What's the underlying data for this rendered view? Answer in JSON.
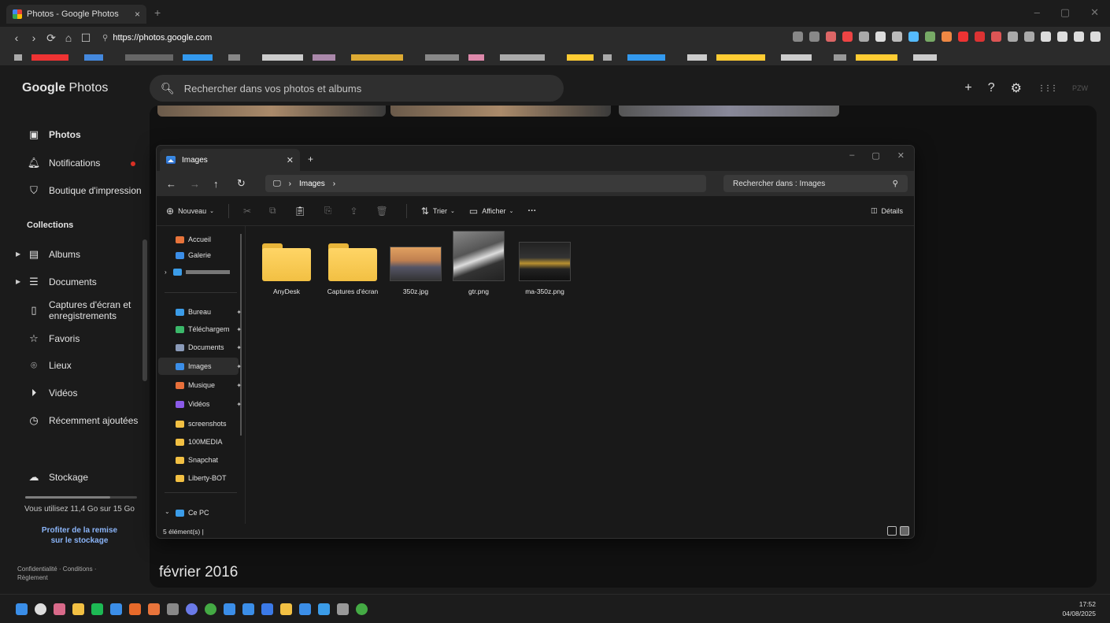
{
  "browser": {
    "tab_title": "Photos - Google Photos",
    "tab_close": "×",
    "new_tab": "+",
    "window_controls": [
      "–",
      "▢",
      "✕"
    ],
    "nav_buttons": [
      "‹",
      "›",
      "⟳",
      "⌂",
      "☐"
    ],
    "url": "https://photos.google.com",
    "extension_colors": [
      "#888888",
      "#888888",
      "#d66",
      "#e44",
      "#aaa",
      "#ddd",
      "#bbb",
      "#5bf",
      "#7a6",
      "#e84",
      "#e33",
      "#d33",
      "#d55",
      "#aaa",
      "#aaa",
      "#ddd",
      "#ddd",
      "#ddd",
      "#ddd"
    ]
  },
  "photos": {
    "logo_bold": "Google",
    "logo_rest": " Photos",
    "search_placeholder": "Rechercher dans vos photos et albums",
    "top_icons": [
      "+",
      "?",
      "⚙",
      "⋮⋮⋮"
    ],
    "account_badge": "PZW",
    "sidebar": {
      "photos": "Photos",
      "notifications": "Notifications",
      "print_store": "Boutique d'impression",
      "collections_title": "Collections",
      "albums": "Albums",
      "documents": "Documents",
      "screenshots_line1": "Captures d'écran et",
      "screenshots_line2": "enregistrements",
      "favorites": "Favoris",
      "places": "Lieux",
      "videos": "Vidéos",
      "recently_added": "Récemment ajoutées",
      "storage": "Stockage",
      "storage_used_fraction": 0.76,
      "usage": "Vous utilisez 11,4 Go sur 15 Go",
      "promo_line1": "Profiter de la remise",
      "promo_line2": "sur le stockage",
      "legal_line1": "Confidentialité · Conditions ·",
      "legal_line2": "Règlement"
    },
    "date_heading": "février 2016"
  },
  "explorer": {
    "tab_title": "Images",
    "tab_close": "✕",
    "new_tab": "+",
    "window_controls": [
      "–",
      "▢",
      "✕"
    ],
    "nav": {
      "back": "←",
      "forward": "→",
      "up": "↑",
      "refresh": "↻"
    },
    "breadcrumb": [
      "Images"
    ],
    "search_placeholder": "Rechercher dans : Images",
    "toolbar": {
      "new": "Nouveau",
      "sort": "Trier",
      "view": "Afficher",
      "more": "···",
      "details": "Détails"
    },
    "nav_pane": [
      {
        "label": "Accueil",
        "color": "#e8743b",
        "pinned": false
      },
      {
        "label": "Galerie",
        "color": "#3b8ee8",
        "pinned": false
      },
      {
        "label": "Bureau",
        "color": "#3b9ce8",
        "pinned": true
      },
      {
        "label": "Téléchargem",
        "color": "#3bb86a",
        "pinned": true
      },
      {
        "label": "Documents",
        "color": "#8a9ab8",
        "pinned": true
      },
      {
        "label": "Images",
        "color": "#3b8ee8",
        "pinned": true
      },
      {
        "label": "Musique",
        "color": "#e8703b",
        "pinned": true
      },
      {
        "label": "Vidéos",
        "color": "#8a5ae8",
        "pinned": true
      },
      {
        "label": "screenshots",
        "color": "#f2c043",
        "pinned": false
      },
      {
        "label": "100MEDIA",
        "color": "#f2c043",
        "pinned": false
      },
      {
        "label": "Snapchat",
        "color": "#f2c043",
        "pinned": false
      },
      {
        "label": "Liberty-BOT",
        "color": "#f2c043",
        "pinned": false
      },
      {
        "label": "Ce PC",
        "color": "#3b9ce8",
        "pinned": false
      }
    ],
    "pin_glyph": "📌",
    "files": [
      {
        "name": "AnyDesk",
        "kind": "folder"
      },
      {
        "name": "Captures d'écran",
        "kind": "folder"
      },
      {
        "name": "350z.jpg",
        "kind": "image"
      },
      {
        "name": "gtr.png",
        "kind": "image"
      },
      {
        "name": "ma-350z.png",
        "kind": "image"
      }
    ],
    "status": "5 élément(s)  |"
  },
  "taskbar": {
    "icon_colors": [
      "#3a8ee8",
      "#ddd",
      "#d96a8a",
      "#f2c043",
      "#1db954",
      "#3b8ee8",
      "#e86a2a",
      "#e8743b",
      "#888",
      "#6a7ae8",
      "#4a4",
      "#3b8ee8",
      "#3b8ee8",
      "#3b7ae8",
      "#f2c043",
      "#3b8ee8",
      "#3b9ce8",
      "#999",
      "#4a4"
    ],
    "time": "17:52",
    "date": "04/08/2025"
  }
}
